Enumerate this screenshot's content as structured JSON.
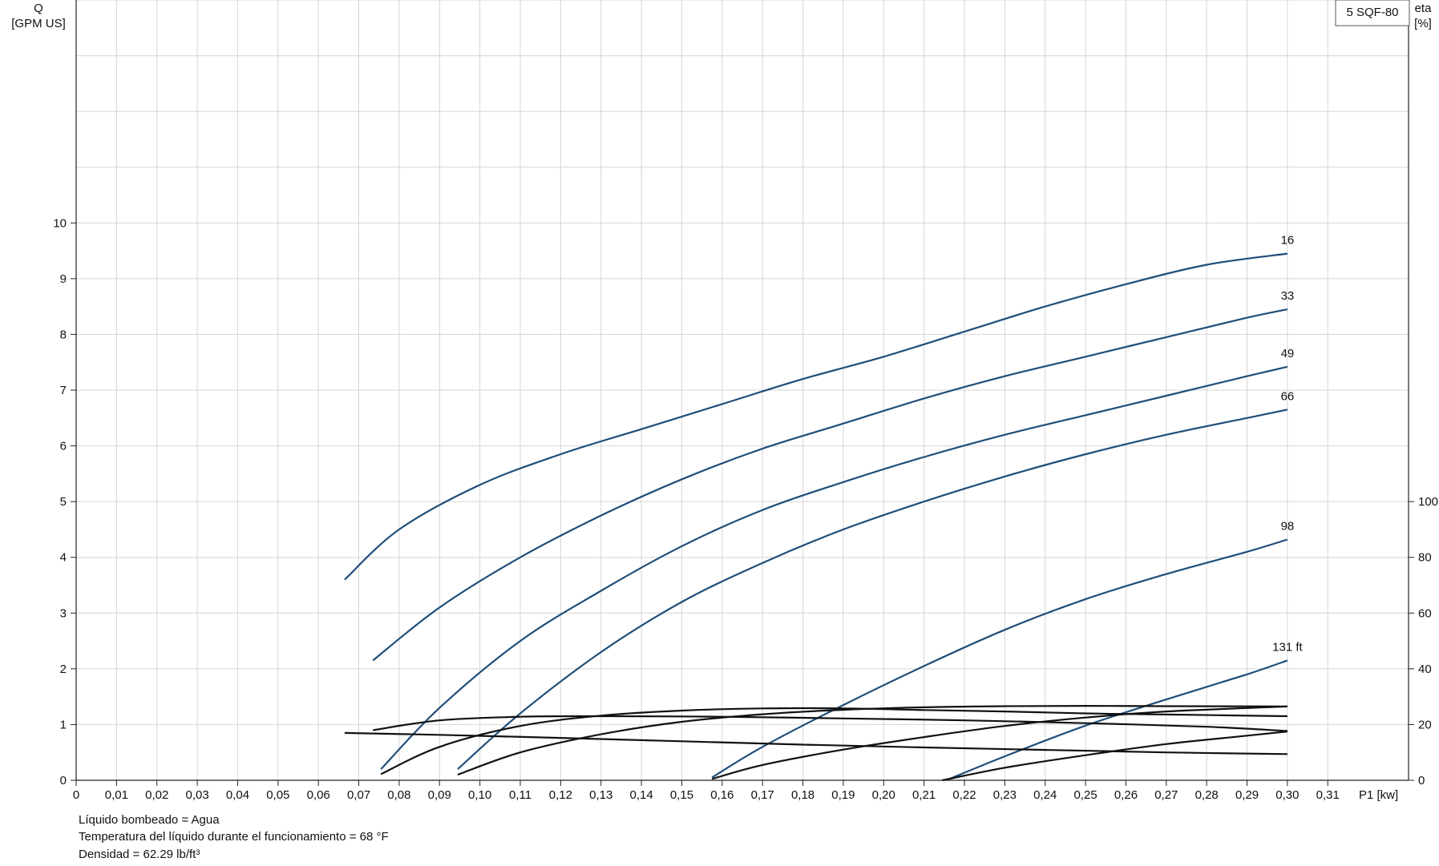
{
  "chart_data": {
    "type": "line",
    "title": "",
    "model_label": "5 SQF-80",
    "x_axis": {
      "label": "P1 [kw]",
      "range": [
        0,
        0.33
      ],
      "ticks": [
        0,
        0.01,
        0.02,
        0.03,
        0.04,
        0.05,
        0.06,
        0.07,
        0.08,
        0.09,
        0.1,
        0.11,
        0.12,
        0.13,
        0.14,
        0.15,
        0.16,
        0.17,
        0.18,
        0.19,
        0.2,
        0.21,
        0.22,
        0.23,
        0.24,
        0.25,
        0.26,
        0.27,
        0.28,
        0.29,
        0.3,
        0.31
      ],
      "tick_labels": [
        "0",
        "0,01",
        "0,02",
        "0,03",
        "0,04",
        "0,05",
        "0,06",
        "0,07",
        "0,08",
        "0,09",
        "0,10",
        "0,11",
        "0,12",
        "0,13",
        "0,14",
        "0,15",
        "0,16",
        "0,17",
        "0,18",
        "0,19",
        "0,20",
        "0,21",
        "0,22",
        "0,23",
        "0,24",
        "0,25",
        "0,26",
        "0,27",
        "0,28",
        "0,29",
        "0,30",
        "0,31"
      ]
    },
    "y_left": {
      "label_line1": "Q",
      "label_line2": "[GPM US]",
      "range": [
        0,
        14
      ],
      "ticks": [
        0,
        1,
        2,
        3,
        4,
        5,
        6,
        7,
        8,
        9,
        10
      ],
      "tick_labels": [
        "0",
        "1",
        "2",
        "3",
        "4",
        "5",
        "6",
        "7",
        "8",
        "9",
        "10"
      ]
    },
    "y_right": {
      "label_line1": "eta",
      "label_line2": "[%]",
      "range": [
        0,
        280
      ],
      "ticks": [
        0,
        20,
        40,
        60,
        80,
        100
      ],
      "tick_labels": [
        "0",
        "20",
        "40",
        "60",
        "80",
        "100"
      ]
    },
    "grid": true,
    "flow_series": [
      {
        "name": "16",
        "color": "#1f4e79",
        "label": "16",
        "x": [
          0.0665,
          0.08,
          0.1,
          0.12,
          0.14,
          0.16,
          0.18,
          0.2,
          0.22,
          0.24,
          0.26,
          0.28,
          0.3
        ],
        "y": [
          3.6,
          4.5,
          5.3,
          5.85,
          6.3,
          6.75,
          7.2,
          7.6,
          8.05,
          8.5,
          8.9,
          9.25,
          9.45
        ]
      },
      {
        "name": "33",
        "color": "#1f4e79",
        "label": "33",
        "x": [
          0.0735,
          0.09,
          0.11,
          0.13,
          0.15,
          0.17,
          0.19,
          0.21,
          0.23,
          0.25,
          0.27,
          0.29,
          0.3
        ],
        "y": [
          2.15,
          3.1,
          4.0,
          4.75,
          5.4,
          5.95,
          6.4,
          6.85,
          7.25,
          7.6,
          7.95,
          8.3,
          8.45
        ]
      },
      {
        "name": "49",
        "color": "#1f4e79",
        "label": "49",
        "x": [
          0.0755,
          0.09,
          0.11,
          0.13,
          0.15,
          0.17,
          0.19,
          0.21,
          0.23,
          0.25,
          0.27,
          0.29,
          0.3
        ],
        "y": [
          0.2,
          1.3,
          2.5,
          3.4,
          4.2,
          4.85,
          5.35,
          5.8,
          6.2,
          6.55,
          6.9,
          7.25,
          7.42
        ]
      },
      {
        "name": "66",
        "color": "#1f4e79",
        "label": "66",
        "x": [
          0.0945,
          0.11,
          0.13,
          0.15,
          0.17,
          0.19,
          0.21,
          0.23,
          0.25,
          0.27,
          0.29,
          0.3
        ],
        "y": [
          0.2,
          1.2,
          2.3,
          3.2,
          3.9,
          4.5,
          5.0,
          5.45,
          5.85,
          6.2,
          6.5,
          6.65
        ]
      },
      {
        "name": "98",
        "color": "#1f4e79",
        "label": "98",
        "x": [
          0.1575,
          0.17,
          0.19,
          0.21,
          0.23,
          0.25,
          0.27,
          0.29,
          0.3
        ],
        "y": [
          0.05,
          0.6,
          1.35,
          2.05,
          2.7,
          3.25,
          3.7,
          4.1,
          4.32
        ]
      },
      {
        "name": "131 ft",
        "color": "#1f4e79",
        "label": "131 ft",
        "x": [
          0.2155,
          0.23,
          0.25,
          0.27,
          0.29,
          0.3
        ],
        "y": [
          0.0,
          0.43,
          0.98,
          1.45,
          1.9,
          2.15
        ]
      }
    ],
    "efficiency_series": [
      {
        "name": "16",
        "color": "#111111",
        "x": [
          0.0665,
          0.09,
          0.12,
          0.15,
          0.18,
          0.21,
          0.24,
          0.27,
          0.3
        ],
        "y": [
          17.0,
          16.3,
          15.2,
          14.0,
          12.8,
          11.8,
          10.9,
          10.0,
          9.4
        ]
      },
      {
        "name": "33",
        "color": "#111111",
        "x": [
          0.0735,
          0.09,
          0.11,
          0.13,
          0.16,
          0.19,
          0.22,
          0.25,
          0.28,
          0.3
        ],
        "y": [
          18.0,
          21.5,
          22.8,
          23.0,
          22.8,
          22.2,
          21.5,
          20.5,
          19.2,
          17.7
        ]
      },
      {
        "name": "49",
        "color": "#111111",
        "x": [
          0.0755,
          0.09,
          0.11,
          0.13,
          0.15,
          0.17,
          0.19,
          0.21,
          0.23,
          0.25,
          0.27,
          0.3
        ],
        "y": [
          2.2,
          12.0,
          19.5,
          23.2,
          25.0,
          25.8,
          25.8,
          25.2,
          24.7,
          24.0,
          23.6,
          23.0
        ]
      },
      {
        "name": "66",
        "color": "#111111",
        "x": [
          0.0945,
          0.11,
          0.13,
          0.15,
          0.17,
          0.19,
          0.21,
          0.23,
          0.25,
          0.27,
          0.3
        ],
        "y": [
          2.0,
          10.0,
          16.5,
          21.0,
          23.7,
          25.3,
          26.2,
          26.6,
          26.7,
          26.6,
          26.5
        ]
      },
      {
        "name": "98",
        "color": "#111111",
        "x": [
          0.1575,
          0.17,
          0.19,
          0.21,
          0.23,
          0.25,
          0.27,
          0.3
        ],
        "y": [
          0.5,
          5.5,
          11.0,
          15.5,
          19.5,
          22.5,
          24.7,
          26.5
        ]
      },
      {
        "name": "131 ft",
        "color": "#111111",
        "x": [
          0.2145,
          0.23,
          0.25,
          0.27,
          0.29,
          0.3
        ],
        "y": [
          0.0,
          4.5,
          9.0,
          13.0,
          16.0,
          17.5
        ]
      }
    ]
  },
  "notes": {
    "line1": "Líquido bombeado = Agua",
    "line2": "Temperatura del líquido durante el funcionamiento = 68 °F",
    "line3": "Densidad = 62.29 lb/ft³"
  }
}
